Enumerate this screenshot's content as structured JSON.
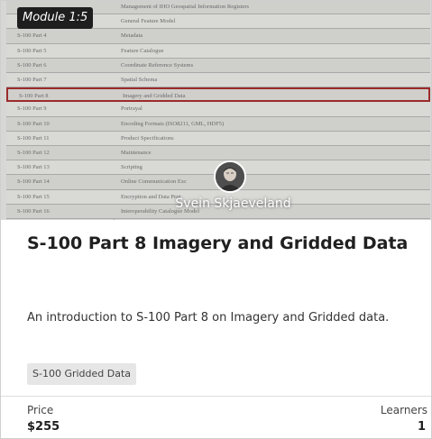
{
  "module_badge": "Module 1:5",
  "thumbnail_rows": [
    {
      "part": "",
      "name": "Management of IHO Geospatial Information Registers"
    },
    {
      "part": "",
      "name": "General Feature Model"
    },
    {
      "part": "S-100 Part 4",
      "name": "Metadata"
    },
    {
      "part": "S-100 Part 5",
      "name": "Feature Catalogue"
    },
    {
      "part": "S-100 Part 6",
      "name": "Coordinate Reference Systems"
    },
    {
      "part": "S-100 Part 7",
      "name": "Spatial Schema"
    },
    {
      "part": "S-100 Part 8",
      "name": "Imagery and Gridded Data",
      "highlight": true
    },
    {
      "part": "S-100 Part 9",
      "name": "Portrayal"
    },
    {
      "part": "S-100 Part 10",
      "name": "Encoding Formats (ISO8211, GML, HDF5)"
    },
    {
      "part": "S-100 Part 11",
      "name": "Product Specifications"
    },
    {
      "part": "S-100 Part 12",
      "name": "Maintenance"
    },
    {
      "part": "S-100 Part 13",
      "name": "Scripting"
    },
    {
      "part": "S-100 Part 14",
      "name": "Online Communication Exc"
    },
    {
      "part": "S-100 Part 15",
      "name": "Encryption and Data Prot"
    },
    {
      "part": "S-100 Part 16",
      "name": "Interoperability Catalogue Model"
    }
  ],
  "author": "Svein Skjaeveland",
  "title": "S-100 Part 8 Imagery and Gridded Data",
  "description": "An introduction to S-100 Part 8 on Imagery and Gridded data.",
  "tag": "S-100 Gridded Data",
  "price_label": "Price",
  "price_value": "$255",
  "learners_label": "Learners",
  "learners_value": "1",
  "colors": {
    "highlight_border": "#9b2b2b",
    "badge_background": "#1e1e1e"
  }
}
